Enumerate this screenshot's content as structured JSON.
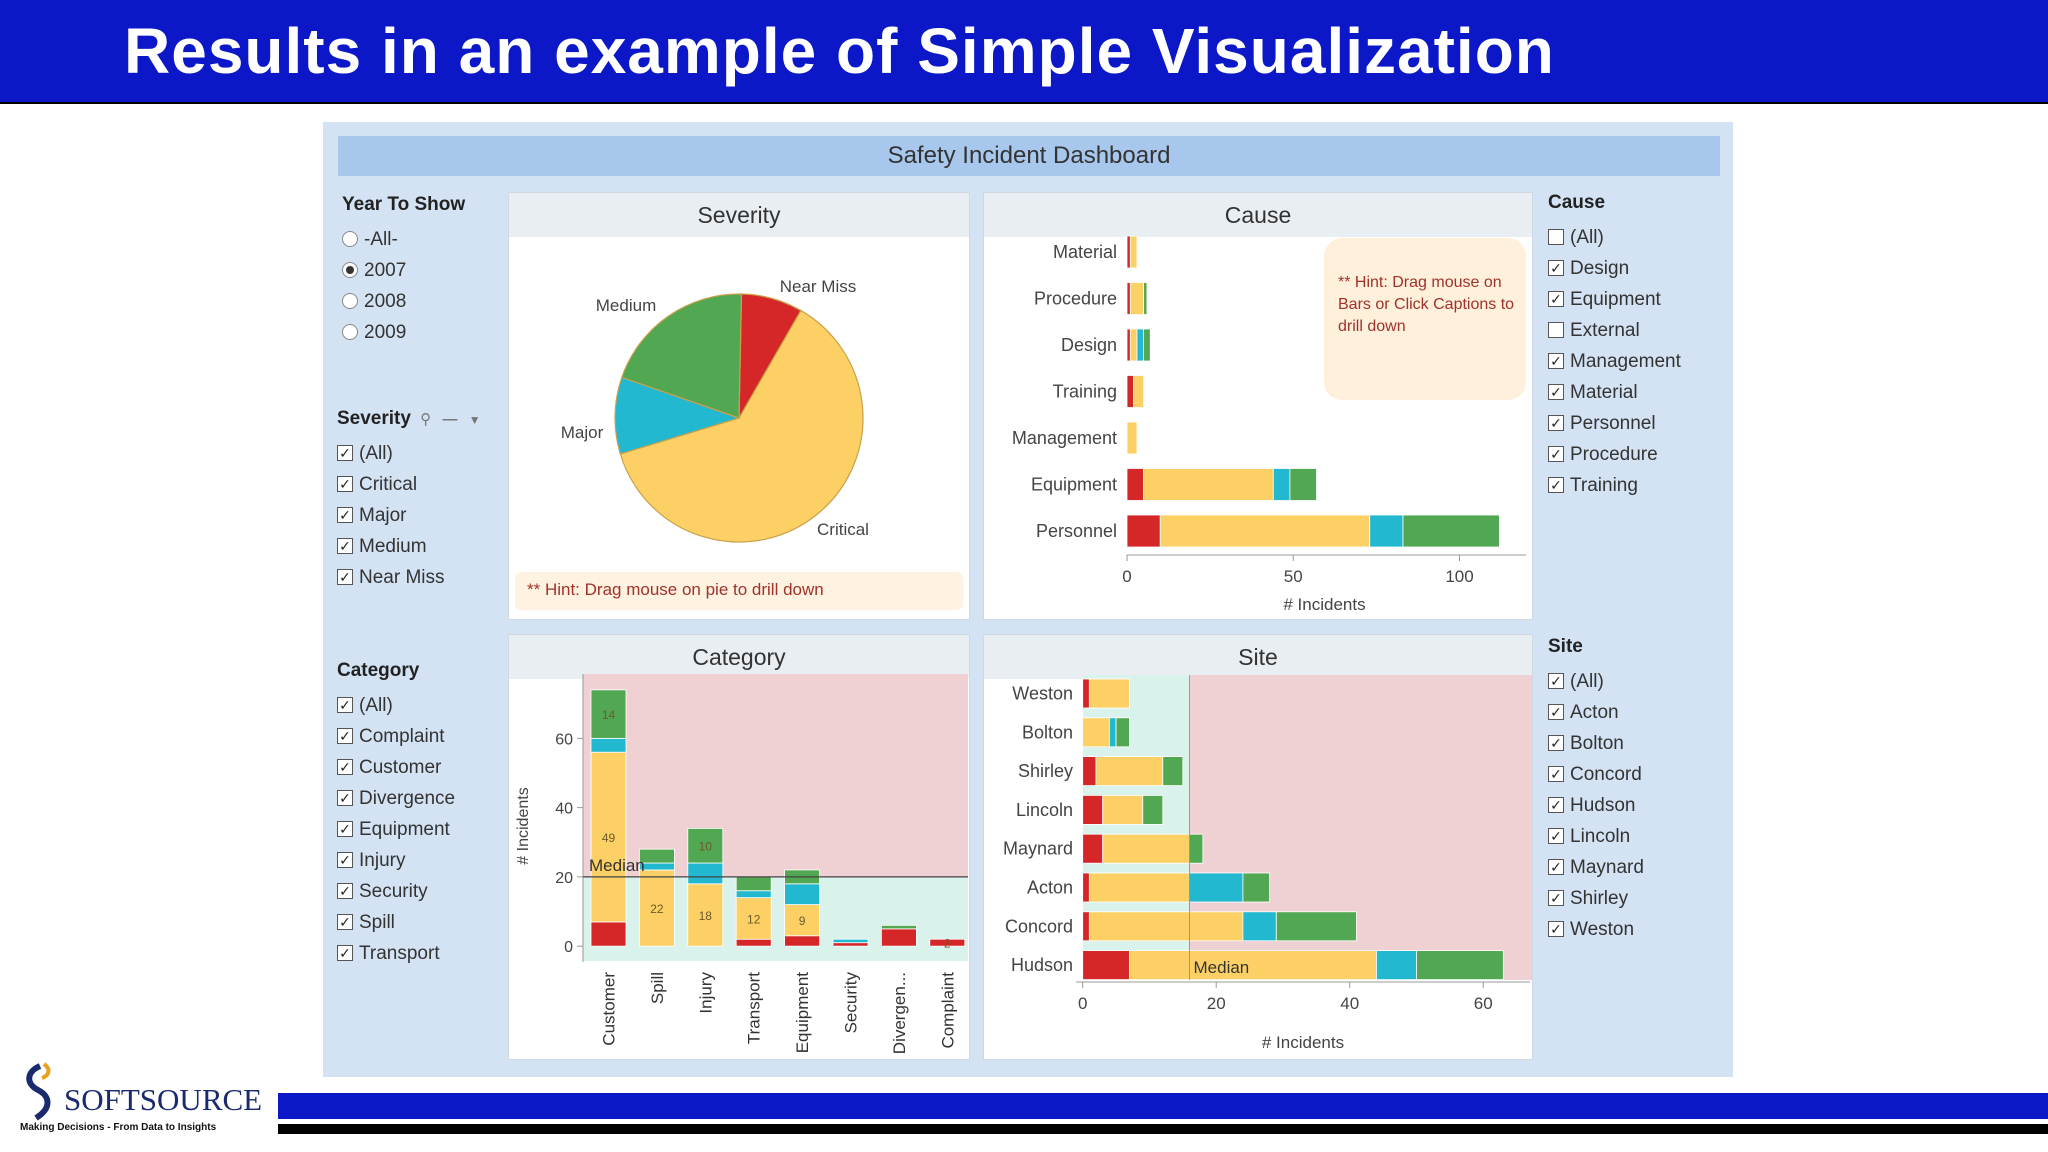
{
  "slide": {
    "title": "Results in an example of Simple Visualization"
  },
  "dashboard": {
    "title": "Safety Incident Dashboard"
  },
  "year_filter": {
    "title": "Year To Show",
    "options": [
      "-All-",
      "2007",
      "2008",
      "2009"
    ],
    "selected": "2007"
  },
  "severity_filter": {
    "title": "Severity",
    "options": [
      "(All)",
      "Critical",
      "Major",
      "Medium",
      "Near Miss"
    ],
    "checked": [
      true,
      true,
      true,
      true,
      true
    ]
  },
  "category_filter": {
    "title": "Category",
    "options": [
      "(All)",
      "Complaint",
      "Customer",
      "Divergence",
      "Equipment",
      "Injury",
      "Security",
      "Spill",
      "Transport"
    ],
    "checked": [
      true,
      true,
      true,
      true,
      true,
      true,
      true,
      true,
      true
    ]
  },
  "cause_filter": {
    "title": "Cause",
    "options": [
      "(All)",
      "Design",
      "Equipment",
      "External",
      "Management",
      "Material",
      "Personnel",
      "Procedure",
      "Training"
    ],
    "checked": [
      false,
      true,
      true,
      false,
      true,
      true,
      true,
      true,
      true
    ]
  },
  "site_filter": {
    "title": "Site",
    "options": [
      "(All)",
      "Acton",
      "Bolton",
      "Concord",
      "Hudson",
      "Lincoln",
      "Maynard",
      "Shirley",
      "Weston"
    ],
    "checked": [
      true,
      true,
      true,
      true,
      true,
      true,
      true,
      true,
      true
    ]
  },
  "colors": {
    "Critical": "#d62728",
    "Major": "#22b8cf",
    "Medium": "#52a852",
    "Near Miss": "#d62728",
    "Severe": "#fdd065",
    "median_band": "#d9f2ec",
    "above_band": "#f0d1d3"
  },
  "severity_panel": {
    "title": "Severity",
    "hint": "** Hint: Drag mouse on pie to drill down"
  },
  "cause_panel": {
    "title": "Cause",
    "hint": "** Hint: Drag mouse on Bars or Click Captions to drill down"
  },
  "category_panel": {
    "title": "Category"
  },
  "site_panel": {
    "title": "Site"
  },
  "chart_data": [
    {
      "type": "pie",
      "title": "Severity",
      "slices": [
        {
          "label": "Near Miss",
          "value": 8,
          "color": "#d62728"
        },
        {
          "label": "Critical",
          "value": 62,
          "color": "#fdd065"
        },
        {
          "label": "Major",
          "value": 10,
          "color": "#22b8cf"
        },
        {
          "label": "Medium",
          "value": 20,
          "color": "#52a852"
        }
      ]
    },
    {
      "type": "bar",
      "orientation": "horizontal",
      "stacked": true,
      "title": "Cause",
      "categories": [
        "Material",
        "Procedure",
        "Design",
        "Training",
        "Management",
        "Equipment",
        "Personnel"
      ],
      "series": [
        {
          "name": "Near Miss",
          "color": "#d62728",
          "values": [
            1,
            1,
            1,
            2,
            0,
            5,
            10
          ]
        },
        {
          "name": "Critical",
          "color": "#fdd065",
          "values": [
            2,
            4,
            2,
            3,
            3,
            39,
            63
          ]
        },
        {
          "name": "Major",
          "color": "#22b8cf",
          "values": [
            0,
            0,
            2,
            0,
            0,
            5,
            10
          ]
        },
        {
          "name": "Medium",
          "color": "#52a852",
          "values": [
            0,
            1,
            2,
            0,
            0,
            8,
            29
          ]
        }
      ],
      "xlabel": "# Incidents",
      "xlim": [
        0,
        120
      ],
      "xticks": [
        0,
        50,
        100
      ]
    },
    {
      "type": "bar",
      "orientation": "vertical",
      "stacked": true,
      "title": "Category",
      "categories": [
        "Customer",
        "Spill",
        "Injury",
        "Transport",
        "Equipment",
        "Security",
        "Divergen...",
        "Complaint"
      ],
      "series": [
        {
          "name": "Near Miss",
          "color": "#d62728",
          "values": [
            7,
            0,
            0,
            2,
            3,
            1,
            5,
            2
          ]
        },
        {
          "name": "Critical",
          "color": "#fdd065",
          "values": [
            49,
            22,
            18,
            12,
            9,
            0,
            0,
            0
          ]
        },
        {
          "name": "Major",
          "color": "#22b8cf",
          "values": [
            4,
            2,
            6,
            2,
            6,
            1,
            0,
            0
          ]
        },
        {
          "name": "Medium",
          "color": "#52a852",
          "values": [
            14,
            4,
            10,
            4,
            4,
            0,
            1,
            0
          ]
        }
      ],
      "segment_labels": [
        [
          "",
          "49",
          "",
          "14"
        ],
        [
          "",
          "22",
          "",
          ""
        ],
        [
          "",
          "18",
          "",
          "10"
        ],
        [
          "",
          "12",
          "",
          ""
        ],
        [
          "",
          "9",
          "",
          ""
        ],
        [
          "",
          "",
          "",
          ""
        ],
        [
          "",
          "",
          "",
          ""
        ],
        [
          "2",
          "",
          "",
          ""
        ]
      ],
      "ylabel": "# Incidents",
      "ylim": [
        -4,
        78
      ],
      "yticks": [
        0,
        20,
        40,
        60
      ],
      "median": 20,
      "median_label": "Median"
    },
    {
      "type": "bar",
      "orientation": "horizontal",
      "stacked": true,
      "title": "Site",
      "categories": [
        "Weston",
        "Bolton",
        "Shirley",
        "Lincoln",
        "Maynard",
        "Acton",
        "Concord",
        "Hudson"
      ],
      "series": [
        {
          "name": "Near Miss",
          "color": "#d62728",
          "values": [
            1,
            0,
            2,
            3,
            3,
            1,
            1,
            7
          ]
        },
        {
          "name": "Critical",
          "color": "#fdd065",
          "values": [
            6,
            4,
            10,
            6,
            13,
            15,
            23,
            37
          ]
        },
        {
          "name": "Major",
          "color": "#22b8cf",
          "values": [
            0,
            1,
            0,
            0,
            0,
            8,
            5,
            6
          ]
        },
        {
          "name": "Medium",
          "color": "#52a852",
          "values": [
            0,
            2,
            3,
            3,
            2,
            4,
            12,
            13
          ]
        }
      ],
      "xlabel": "# Incidents",
      "xlim": [
        -1,
        67
      ],
      "xticks": [
        0,
        20,
        40,
        60
      ],
      "median": 16,
      "median_label": "Median"
    }
  ],
  "footer": {
    "company": "SOFTSOURCE",
    "tagline": "Making Decisions - From Data to Insights"
  }
}
